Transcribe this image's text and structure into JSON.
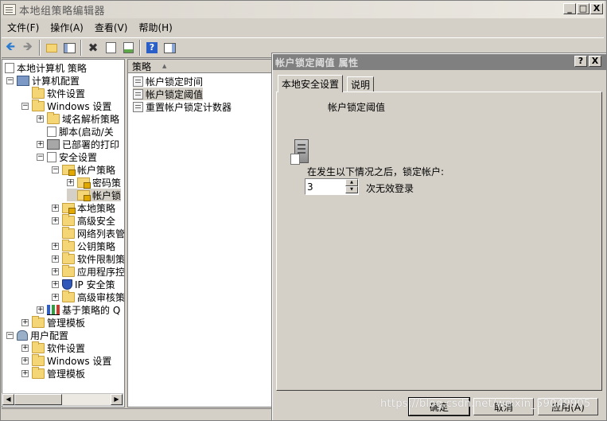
{
  "window": {
    "title": "本地组策略编辑器"
  },
  "window_buttons": {
    "minimize": "_",
    "maximize": "□",
    "close": "X"
  },
  "menu": {
    "items": [
      "文件(F)",
      "操作(A)",
      "查看(V)",
      "帮助(H)"
    ]
  },
  "tree": {
    "items": [
      {
        "label": "本地计算机 策略"
      },
      {
        "label": "计算机配置"
      },
      {
        "label": "软件设置"
      },
      {
        "label": "Windows 设置"
      },
      {
        "label": "域名解析策略"
      },
      {
        "label": "脚本(启动/关"
      },
      {
        "label": "已部署的打印"
      },
      {
        "label": "安全设置"
      },
      {
        "label": "帐户策略"
      },
      {
        "label": "密码策"
      },
      {
        "label": "帐户锁"
      },
      {
        "label": "本地策略"
      },
      {
        "label": "高级安全"
      },
      {
        "label": "网络列表管"
      },
      {
        "label": "公钥策略"
      },
      {
        "label": "软件限制策"
      },
      {
        "label": "应用程序控"
      },
      {
        "label": "IP 安全策"
      },
      {
        "label": "高级审核策"
      },
      {
        "label": "基于策略的 Q"
      },
      {
        "label": "管理模板"
      },
      {
        "label": "用户配置"
      },
      {
        "label": "软件设置"
      },
      {
        "label": "Windows 设置"
      },
      {
        "label": "管理模板"
      }
    ]
  },
  "list": {
    "column_header": "策略",
    "rows": [
      {
        "label": "帐户锁定时间"
      },
      {
        "label": "帐户锁定阈值"
      },
      {
        "label": "重置帐户锁定计数器"
      }
    ]
  },
  "dialog": {
    "title": "帐户锁定阈值 属性",
    "help": "?",
    "close": "X",
    "tabs": [
      {
        "label": "本地安全设置"
      },
      {
        "label": "说明"
      }
    ],
    "policy_name": "帐户锁定阈值",
    "prompt": "在发生以下情况之后，锁定帐户:",
    "value": "3",
    "unit": "次无效登录",
    "buttons": {
      "ok": "确定",
      "cancel": "取消",
      "apply": "应用(A)"
    }
  },
  "watermark": "https://blog.csdn.net/weixin_59049905"
}
